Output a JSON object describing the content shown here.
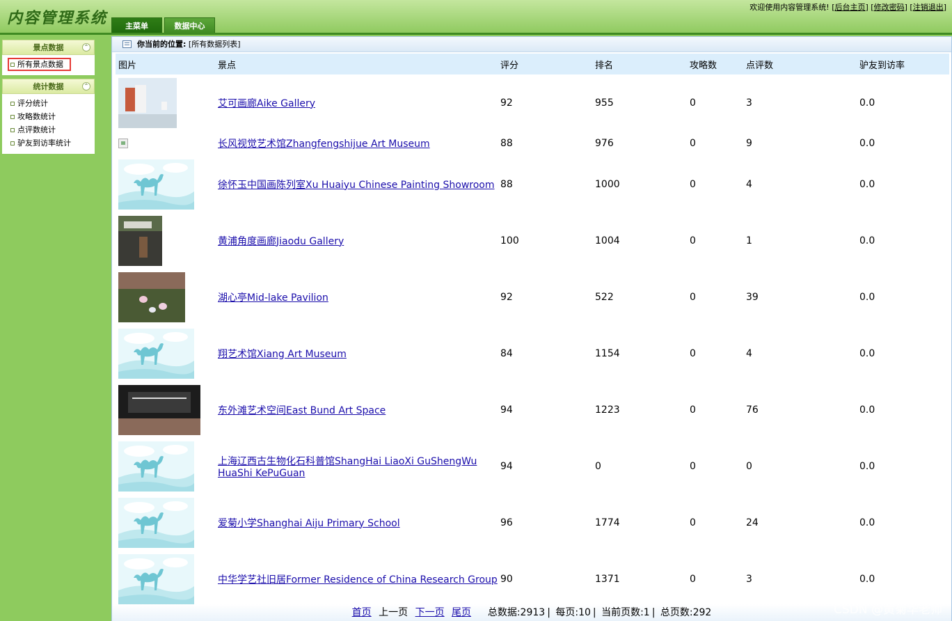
{
  "header": {
    "title": "内容管理系统",
    "welcome": "欢迎使用内容管理系统!",
    "links": [
      "后台主页",
      "修改密码",
      "注销退出"
    ],
    "tabs": [
      "主菜单",
      "数据中心"
    ]
  },
  "sidebar": {
    "groups": [
      {
        "title": "景点数据",
        "items": [
          "所有景点数据"
        ]
      },
      {
        "title": "统计数据",
        "items": [
          "评分统计",
          "攻略数统计",
          "点评数统计",
          "驴友到访率统计"
        ]
      }
    ]
  },
  "breadcrumb": {
    "label": "你当前的位置:",
    "value": "[所有数据列表]"
  },
  "table": {
    "headers": [
      "图片",
      "景点",
      "评分",
      "排名",
      "攻略数",
      "点评数",
      "驴友到访率"
    ],
    "rows": [
      {
        "name": "艾可画廊Aike Gallery",
        "score": "92",
        "rank": "955",
        "guides": "0",
        "reviews": "3",
        "rate": "0.0",
        "img": "gallery"
      },
      {
        "name": "长风视觉艺术馆Zhangfengshijue Art Museum",
        "score": "88",
        "rank": "976",
        "guides": "0",
        "reviews": "9",
        "rate": "0.0",
        "img": "broken"
      },
      {
        "name": "徐怀玉中国画陈列室Xu Huaiyu Chinese Painting Showroom",
        "score": "88",
        "rank": "1000",
        "guides": "0",
        "reviews": "4",
        "rate": "0.0",
        "img": "camel"
      },
      {
        "name": "黄浦角度画廊Jiaodu Gallery",
        "score": "100",
        "rank": "1004",
        "guides": "0",
        "reviews": "1",
        "rate": "0.0",
        "img": "street"
      },
      {
        "name": "湖心亭Mid-lake Pavilion",
        "score": "92",
        "rank": "522",
        "guides": "0",
        "reviews": "39",
        "rate": "0.0",
        "img": "pond"
      },
      {
        "name": "翔艺术馆Xiang Art Museum",
        "score": "84",
        "rank": "1154",
        "guides": "0",
        "reviews": "4",
        "rate": "0.0",
        "img": "camel"
      },
      {
        "name": "东外滩艺术空间East Bund Art Space",
        "score": "94",
        "rank": "1223",
        "guides": "0",
        "reviews": "76",
        "rate": "0.0",
        "img": "hall"
      },
      {
        "name": "上海辽西古生物化石科普馆ShangHai LiaoXi GuShengWu HuaShi KePuGuan",
        "score": "94",
        "rank": "0",
        "guides": "0",
        "reviews": "0",
        "rate": "0.0",
        "img": "camel"
      },
      {
        "name": "爱菊小学Shanghai Aiju Primary School",
        "score": "96",
        "rank": "1774",
        "guides": "0",
        "reviews": "24",
        "rate": "0.0",
        "img": "camel"
      },
      {
        "name": "中华学艺社旧居Former Residence of China Research Group",
        "score": "90",
        "rank": "1371",
        "guides": "0",
        "reviews": "3",
        "rate": "0.0",
        "img": "camel"
      }
    ]
  },
  "pager": {
    "first": "首页",
    "prev": "上一页",
    "next": "下一页",
    "last": "尾页",
    "total": "总数据:2913",
    "per_page": "每页:10",
    "current": "当前页数:1",
    "pages": "总页数:292"
  },
  "watermark": "CSDN @黄菊华老师",
  "colors": {
    "header_green": "#8fca5f",
    "tab_active": "#1f6a0c",
    "table_header": "#dbeefc",
    "link": "#1a0dab",
    "selected_outline": "#e53935"
  }
}
